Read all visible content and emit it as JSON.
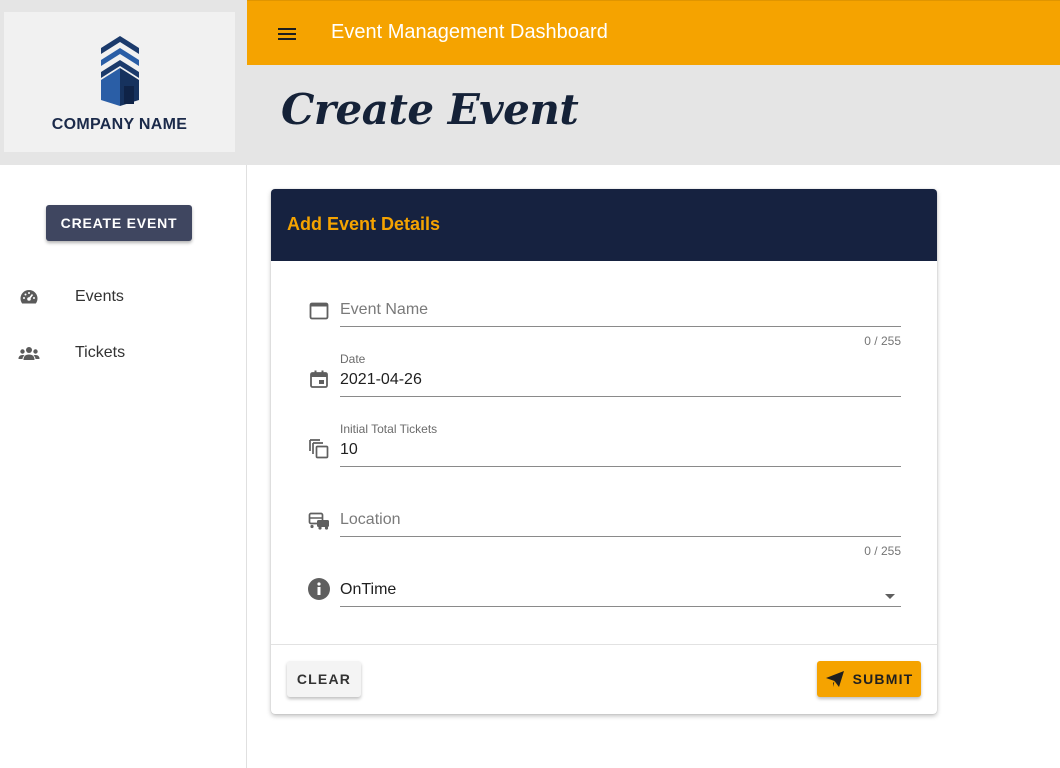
{
  "sidebar": {
    "logo_text": "COMPANY NAME",
    "create_button": "CREATE EVENT",
    "items": [
      {
        "label": "Events",
        "icon": "dashboard-gauge-icon"
      },
      {
        "label": "Tickets",
        "icon": "users-group-icon"
      }
    ]
  },
  "topbar": {
    "title": "Event Management Dashboard",
    "menu_icon": "hamburger-menu-icon"
  },
  "page": {
    "title": "Create Event"
  },
  "form": {
    "header": "Add Event Details",
    "event_name": {
      "placeholder": "Event Name",
      "value": "",
      "counter": "0 / 255",
      "icon": "window-icon"
    },
    "date": {
      "label": "Date",
      "value": "2021-04-26",
      "icon": "calendar-icon"
    },
    "tickets": {
      "label": "Initial Total Tickets",
      "value": "10",
      "icon": "copy-icon"
    },
    "location": {
      "placeholder": "Location",
      "value": "",
      "counter": "0 / 255",
      "icon": "bus-icon"
    },
    "status": {
      "value": "OnTime",
      "icon": "info-icon"
    },
    "clear_button": "CLEAR",
    "submit_button": "SUBMIT"
  },
  "colors": {
    "accent": "#f5a300",
    "navy": "#162240",
    "button_dark": "#3f4660"
  }
}
